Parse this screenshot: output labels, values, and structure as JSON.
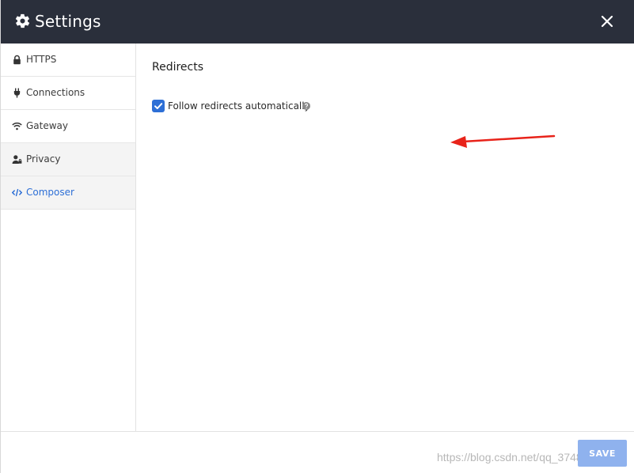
{
  "window": {
    "title": "Settings",
    "header_icon": "gear-icon",
    "close_icon": "close-icon",
    "header_color": "#2a2f3b"
  },
  "sidebar": {
    "items": [
      {
        "label": "HTTPS",
        "icon": "lock-icon"
      },
      {
        "label": "Connections",
        "icon": "plug-icon"
      },
      {
        "label": "Gateway",
        "icon": "wifi-icon"
      },
      {
        "label": "Privacy",
        "icon": "user-lock-icon"
      },
      {
        "label": "Composer",
        "icon": "code-icon",
        "active": true
      }
    ],
    "active_color": "#2d6fd6"
  },
  "main": {
    "section_title": "Redirects",
    "options": [
      {
        "label": "Follow redirects automatically",
        "checked": true,
        "help_icon": "question-circle-icon"
      }
    ]
  },
  "footer": {
    "save_label": "SAVE",
    "watermark": "https://blog.csdn.net/qq_37485571"
  },
  "annotation": {
    "arrow_color": "#e8231a"
  }
}
